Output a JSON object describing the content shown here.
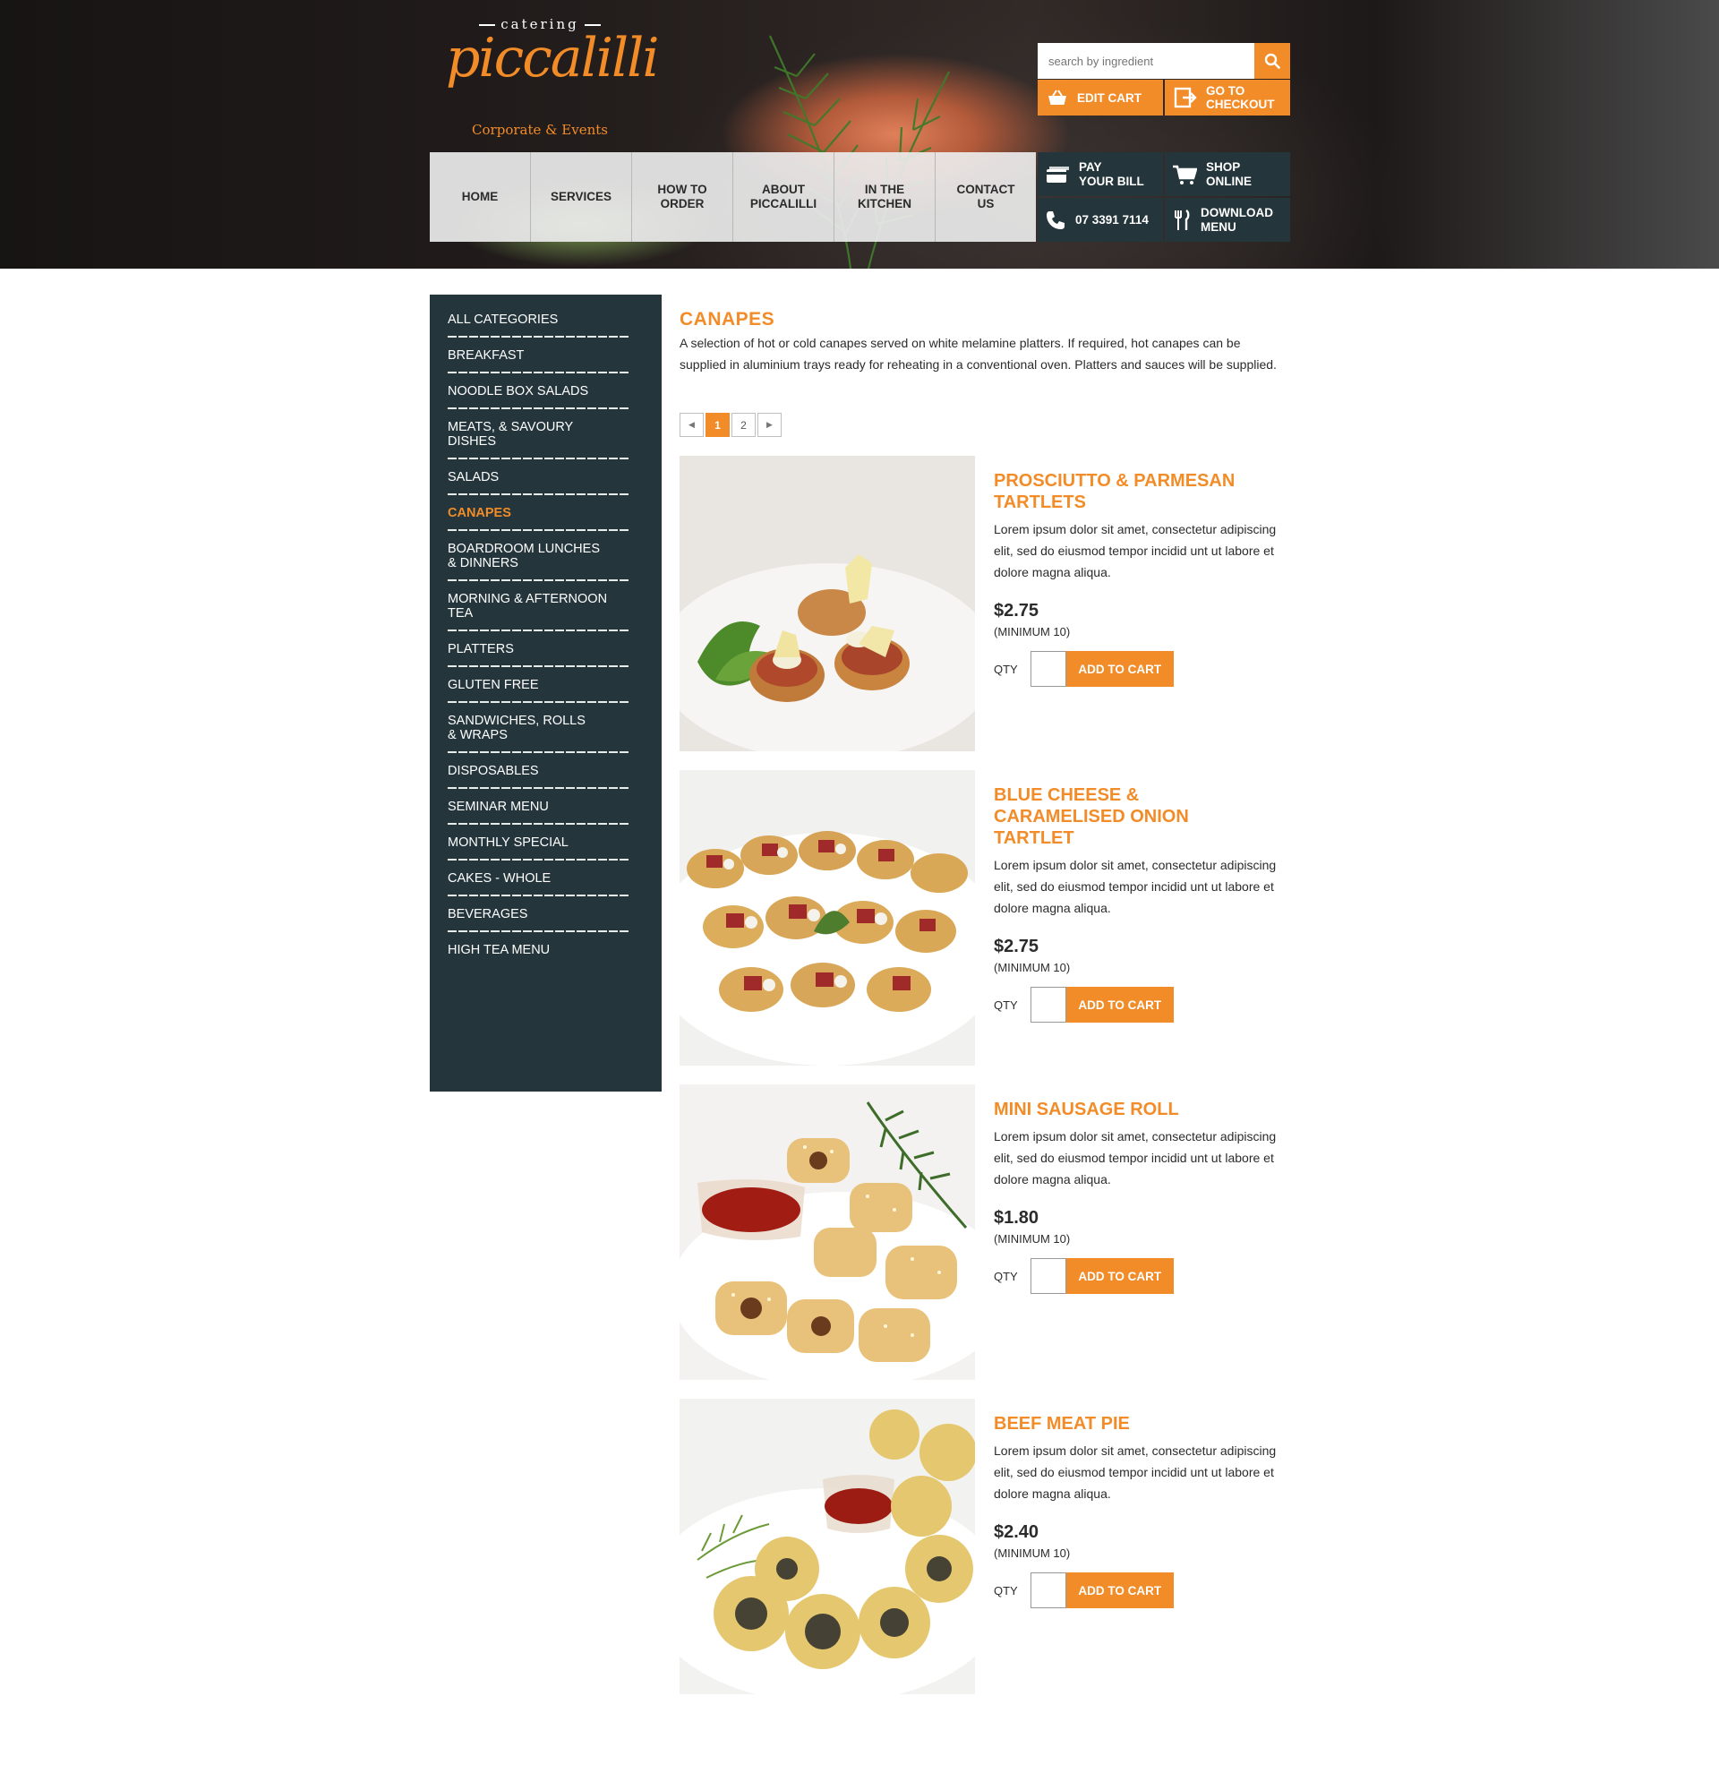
{
  "brand": {
    "small": "catering",
    "script": "piccalilli",
    "tagline": "Corporate & Events",
    "accent": "#f28c28",
    "dark": "#24353b"
  },
  "search": {
    "placeholder": "search by ingredient",
    "icon": "search-icon"
  },
  "cart": {
    "edit_label": "EDIT CART",
    "checkout_line1": "GO TO",
    "checkout_line2": "CHECKOUT"
  },
  "nav": [
    {
      "line1": "HOME",
      "line2": ""
    },
    {
      "line1": "SERVICES",
      "line2": ""
    },
    {
      "line1": "HOW TO",
      "line2": "ORDER"
    },
    {
      "line1": "ABOUT",
      "line2": "PICCALILLI"
    },
    {
      "line1": "IN THE",
      "line2": "KITCHEN"
    },
    {
      "line1": "CONTACT",
      "line2": "US"
    }
  ],
  "quick": {
    "pay_line1": "PAY",
    "pay_line2": "YOUR BILL",
    "shop_line1": "SHOP",
    "shop_line2": "ONLINE",
    "phone": "07 3391 7114",
    "menu_line1": "DOWNLOAD",
    "menu_line2": "MENU"
  },
  "sidebar": {
    "categories": [
      {
        "line1": "ALL CATEGORIES",
        "line2": ""
      },
      {
        "line1": "BREAKFAST",
        "line2": ""
      },
      {
        "line1": "NOODLE BOX SALADS",
        "line2": ""
      },
      {
        "line1": "MEATS, & SAVOURY",
        "line2": "DISHES"
      },
      {
        "line1": "SALADS",
        "line2": ""
      },
      {
        "line1": "CANAPES",
        "line2": ""
      },
      {
        "line1": "BOARDROOM LUNCHES",
        "line2": "& DINNERS"
      },
      {
        "line1": "MORNING & AFTERNOON",
        "line2": "TEA"
      },
      {
        "line1": "PLATTERS",
        "line2": ""
      },
      {
        "line1": "GLUTEN FREE",
        "line2": ""
      },
      {
        "line1": "SANDWICHES, ROLLS",
        "line2": "& WRAPS"
      },
      {
        "line1": "DISPOSABLES",
        "line2": ""
      },
      {
        "line1": "SEMINAR MENU",
        "line2": ""
      },
      {
        "line1": "MONTHLY SPECIAL",
        "line2": ""
      },
      {
        "line1": "CAKES - WHOLE",
        "line2": ""
      },
      {
        "line1": "BEVERAGES",
        "line2": ""
      },
      {
        "line1": "HIGH TEA MENU",
        "line2": ""
      }
    ],
    "active": "CANAPES"
  },
  "page": {
    "title": "CANAPES",
    "description": "A selection of hot or cold canapes served on white melamine platters. If required, hot canapes can be supplied in aluminium trays ready for reheating in a conventional oven. Platters and sauces will be supplied."
  },
  "pager": {
    "prev": "◀",
    "next": "▶",
    "pages": [
      "1",
      "2"
    ],
    "current": "1"
  },
  "products": [
    {
      "name_lines": [
        "PROSCIUTTO & PARMESAN",
        "TARTLETS"
      ],
      "desc": "Lorem ipsum dolor sit amet, consectetur adipiscing elit, sed do eiusmod tempor incidid unt ut labore et dolore magna aliqua.",
      "price": "$2.75",
      "min": "(MINIMUM 10)",
      "qty_label": "QTY",
      "add_label": "ADD TO CART"
    },
    {
      "name_lines": [
        "BLUE CHEESE &",
        "CARAMELISED ONION",
        "TARTLET"
      ],
      "desc": "Lorem ipsum dolor sit amet, consectetur adipiscing elit, sed do eiusmod tempor incidid unt ut labore et dolore magna aliqua.",
      "price": "$2.75",
      "min": "(MINIMUM 10)",
      "qty_label": "QTY",
      "add_label": "ADD TO CART"
    },
    {
      "name_lines": [
        "MINI SAUSAGE ROLL"
      ],
      "desc": "Lorem ipsum dolor sit amet, consectetur adipiscing elit, sed do eiusmod tempor incidid unt ut labore et dolore magna aliqua.",
      "price": "$1.80",
      "min": "(MINIMUM 10)",
      "qty_label": "QTY",
      "add_label": "ADD TO CART"
    },
    {
      "name_lines": [
        "BEEF MEAT PIE"
      ],
      "desc": "Lorem ipsum dolor sit amet, consectetur adipiscing elit, sed do eiusmod tempor incidid unt ut labore et dolore magna aliqua.",
      "price": "$2.40",
      "min": "(MINIMUM 10)",
      "qty_label": "QTY",
      "add_label": "ADD TO CART"
    }
  ]
}
